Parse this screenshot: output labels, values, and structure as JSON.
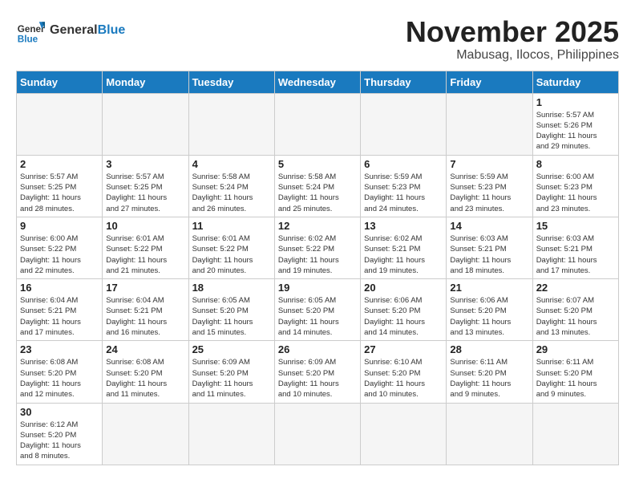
{
  "header": {
    "logo_general": "General",
    "logo_blue": "Blue",
    "month_title": "November 2025",
    "location": "Mabusag, Ilocos, Philippines"
  },
  "weekdays": [
    "Sunday",
    "Monday",
    "Tuesday",
    "Wednesday",
    "Thursday",
    "Friday",
    "Saturday"
  ],
  "weeks": [
    [
      {
        "day": "",
        "info": ""
      },
      {
        "day": "",
        "info": ""
      },
      {
        "day": "",
        "info": ""
      },
      {
        "day": "",
        "info": ""
      },
      {
        "day": "",
        "info": ""
      },
      {
        "day": "",
        "info": ""
      },
      {
        "day": "1",
        "info": "Sunrise: 5:57 AM\nSunset: 5:26 PM\nDaylight: 11 hours\nand 29 minutes."
      }
    ],
    [
      {
        "day": "2",
        "info": "Sunrise: 5:57 AM\nSunset: 5:25 PM\nDaylight: 11 hours\nand 28 minutes."
      },
      {
        "day": "3",
        "info": "Sunrise: 5:57 AM\nSunset: 5:25 PM\nDaylight: 11 hours\nand 27 minutes."
      },
      {
        "day": "4",
        "info": "Sunrise: 5:58 AM\nSunset: 5:24 PM\nDaylight: 11 hours\nand 26 minutes."
      },
      {
        "day": "5",
        "info": "Sunrise: 5:58 AM\nSunset: 5:24 PM\nDaylight: 11 hours\nand 25 minutes."
      },
      {
        "day": "6",
        "info": "Sunrise: 5:59 AM\nSunset: 5:23 PM\nDaylight: 11 hours\nand 24 minutes."
      },
      {
        "day": "7",
        "info": "Sunrise: 5:59 AM\nSunset: 5:23 PM\nDaylight: 11 hours\nand 23 minutes."
      },
      {
        "day": "8",
        "info": "Sunrise: 6:00 AM\nSunset: 5:23 PM\nDaylight: 11 hours\nand 23 minutes."
      }
    ],
    [
      {
        "day": "9",
        "info": "Sunrise: 6:00 AM\nSunset: 5:22 PM\nDaylight: 11 hours\nand 22 minutes."
      },
      {
        "day": "10",
        "info": "Sunrise: 6:01 AM\nSunset: 5:22 PM\nDaylight: 11 hours\nand 21 minutes."
      },
      {
        "day": "11",
        "info": "Sunrise: 6:01 AM\nSunset: 5:22 PM\nDaylight: 11 hours\nand 20 minutes."
      },
      {
        "day": "12",
        "info": "Sunrise: 6:02 AM\nSunset: 5:22 PM\nDaylight: 11 hours\nand 19 minutes."
      },
      {
        "day": "13",
        "info": "Sunrise: 6:02 AM\nSunset: 5:21 PM\nDaylight: 11 hours\nand 19 minutes."
      },
      {
        "day": "14",
        "info": "Sunrise: 6:03 AM\nSunset: 5:21 PM\nDaylight: 11 hours\nand 18 minutes."
      },
      {
        "day": "15",
        "info": "Sunrise: 6:03 AM\nSunset: 5:21 PM\nDaylight: 11 hours\nand 17 minutes."
      }
    ],
    [
      {
        "day": "16",
        "info": "Sunrise: 6:04 AM\nSunset: 5:21 PM\nDaylight: 11 hours\nand 17 minutes."
      },
      {
        "day": "17",
        "info": "Sunrise: 6:04 AM\nSunset: 5:21 PM\nDaylight: 11 hours\nand 16 minutes."
      },
      {
        "day": "18",
        "info": "Sunrise: 6:05 AM\nSunset: 5:20 PM\nDaylight: 11 hours\nand 15 minutes."
      },
      {
        "day": "19",
        "info": "Sunrise: 6:05 AM\nSunset: 5:20 PM\nDaylight: 11 hours\nand 14 minutes."
      },
      {
        "day": "20",
        "info": "Sunrise: 6:06 AM\nSunset: 5:20 PM\nDaylight: 11 hours\nand 14 minutes."
      },
      {
        "day": "21",
        "info": "Sunrise: 6:06 AM\nSunset: 5:20 PM\nDaylight: 11 hours\nand 13 minutes."
      },
      {
        "day": "22",
        "info": "Sunrise: 6:07 AM\nSunset: 5:20 PM\nDaylight: 11 hours\nand 13 minutes."
      }
    ],
    [
      {
        "day": "23",
        "info": "Sunrise: 6:08 AM\nSunset: 5:20 PM\nDaylight: 11 hours\nand 12 minutes."
      },
      {
        "day": "24",
        "info": "Sunrise: 6:08 AM\nSunset: 5:20 PM\nDaylight: 11 hours\nand 11 minutes."
      },
      {
        "day": "25",
        "info": "Sunrise: 6:09 AM\nSunset: 5:20 PM\nDaylight: 11 hours\nand 11 minutes."
      },
      {
        "day": "26",
        "info": "Sunrise: 6:09 AM\nSunset: 5:20 PM\nDaylight: 11 hours\nand 10 minutes."
      },
      {
        "day": "27",
        "info": "Sunrise: 6:10 AM\nSunset: 5:20 PM\nDaylight: 11 hours\nand 10 minutes."
      },
      {
        "day": "28",
        "info": "Sunrise: 6:11 AM\nSunset: 5:20 PM\nDaylight: 11 hours\nand 9 minutes."
      },
      {
        "day": "29",
        "info": "Sunrise: 6:11 AM\nSunset: 5:20 PM\nDaylight: 11 hours\nand 9 minutes."
      }
    ],
    [
      {
        "day": "30",
        "info": "Sunrise: 6:12 AM\nSunset: 5:20 PM\nDaylight: 11 hours\nand 8 minutes."
      },
      {
        "day": "",
        "info": ""
      },
      {
        "day": "",
        "info": ""
      },
      {
        "day": "",
        "info": ""
      },
      {
        "day": "",
        "info": ""
      },
      {
        "day": "",
        "info": ""
      },
      {
        "day": "",
        "info": ""
      }
    ]
  ]
}
